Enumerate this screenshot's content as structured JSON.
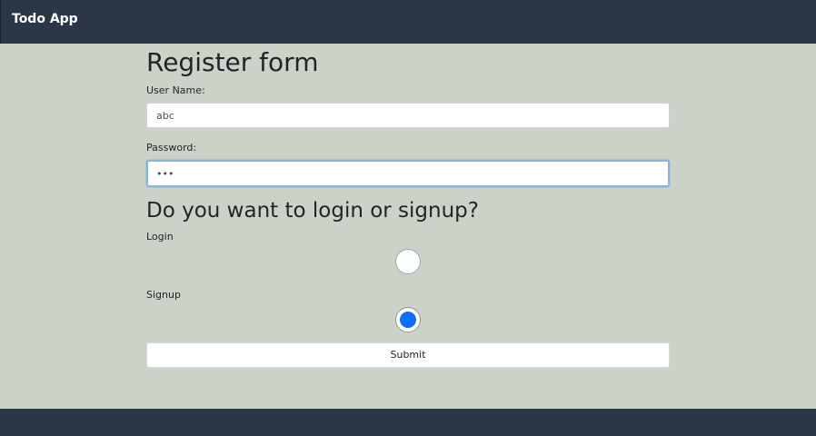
{
  "navbar": {
    "brand": "Todo App"
  },
  "form": {
    "title": "Register form",
    "username": {
      "label": "User Name:",
      "value": "abc"
    },
    "password": {
      "label": "Password:",
      "value": "•••"
    },
    "mode_question": "Do you want to login or signup?",
    "options": [
      {
        "label": "Login",
        "checked": false
      },
      {
        "label": "Signup",
        "checked": true
      }
    ],
    "submit_label": "Submit"
  },
  "colors": {
    "navbar_bg": "#2b3746",
    "page_bg": "#cbd3c8",
    "radio_accent": "#0d6efd"
  }
}
